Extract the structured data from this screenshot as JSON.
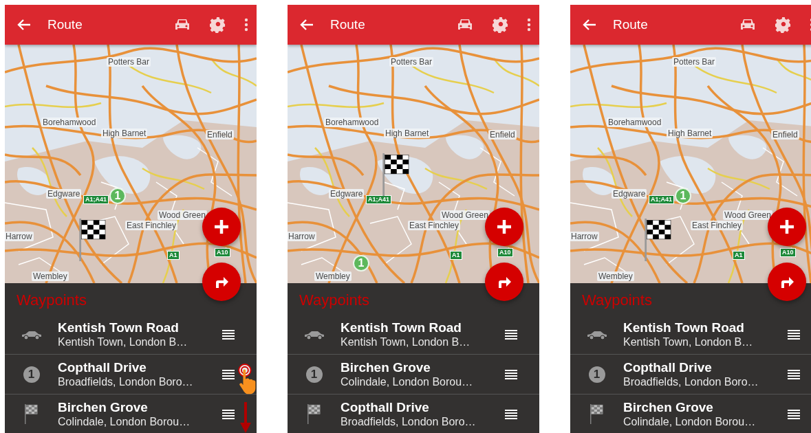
{
  "panels": [
    {
      "app_bar": {
        "title": "Route"
      },
      "map": {
        "places": [
          "Potters Bar",
          "Borehamwood",
          "High Barnet",
          "Enfield",
          "Edgware",
          "Wood Green",
          "East Finchley",
          "Harrow",
          "Wembley"
        ],
        "shields": [
          "A1;A41",
          "A1",
          "A10"
        ],
        "markers": [
          {
            "kind": "number",
            "text": "1"
          },
          {
            "kind": "flag"
          }
        ]
      },
      "waypoints": {
        "title": "Waypoints",
        "items": [
          {
            "kind": "car",
            "title": "Kentish Town Road",
            "subtitle": "Kentish Town, London B…"
          },
          {
            "kind": "number",
            "badge": "1",
            "title": "Copthall Drive",
            "subtitle": "Broadfields, London Boro…"
          },
          {
            "kind": "flag",
            "title": "Birchen Grove",
            "subtitle": "Colindale, London Borou…"
          }
        ]
      },
      "gesture": {
        "kind": "drag-down"
      }
    },
    {
      "app_bar": {
        "title": "Route"
      },
      "map": {
        "places": [
          "Potters Bar",
          "Borehamwood",
          "High Barnet",
          "Enfield",
          "Edgware",
          "Wood Green",
          "East Finchley",
          "Harrow",
          "Wembley"
        ],
        "shields": [
          "A1;A41",
          "A1",
          "A10"
        ],
        "markers": [
          {
            "kind": "flag"
          },
          {
            "kind": "number",
            "text": "1"
          }
        ]
      },
      "waypoints": {
        "title": "Waypoints",
        "items": [
          {
            "kind": "car",
            "title": "Kentish Town Road",
            "subtitle": "Kentish Town, London B…"
          },
          {
            "kind": "number",
            "badge": "1",
            "title": "Birchen Grove",
            "subtitle": "Colindale, London Borou…"
          },
          {
            "kind": "flag",
            "title": "Copthall Drive",
            "subtitle": "Broadfields, London Boro…"
          }
        ]
      }
    },
    {
      "app_bar": {
        "title": "Route"
      },
      "map": {
        "places": [
          "Potters Bar",
          "Borehamwood",
          "High Barnet",
          "Enfield",
          "Edgware",
          "Wood Green",
          "East Finchley",
          "Harrow",
          "Wembley"
        ],
        "shields": [
          "A1;A41",
          "A1",
          "A10"
        ],
        "markers": [
          {
            "kind": "number",
            "text": "1"
          },
          {
            "kind": "flag"
          }
        ]
      },
      "waypoints": {
        "title": "Waypoints",
        "items": [
          {
            "kind": "car",
            "title": "Kentish Town Road",
            "subtitle": "Kentish Town, London B…"
          },
          {
            "kind": "number",
            "badge": "1",
            "title": "Copthall Drive",
            "subtitle": "Broadfields, London Boro…"
          },
          {
            "kind": "flag",
            "title": "Birchen Grove",
            "subtitle": "Colindale, London Borou…"
          }
        ]
      }
    }
  ]
}
